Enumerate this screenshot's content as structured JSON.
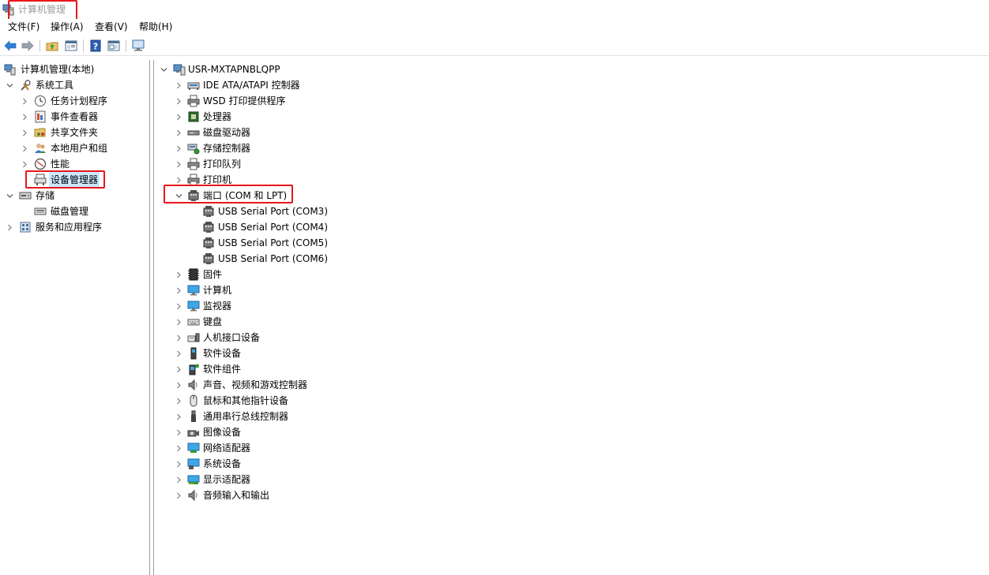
{
  "window": {
    "title": "计算机管理"
  },
  "menu": [
    "文件(F)",
    "操作(A)",
    "查看(V)",
    "帮助(H)"
  ],
  "toolbar": [
    "back-arrow-icon",
    "forward-arrow-icon",
    "up-folder-icon",
    "show-hide-tree-icon",
    "help-icon",
    "properties-icon",
    "monitor-icon"
  ],
  "left_tree": {
    "root": "计算机管理(本地)",
    "system_tools": "系统工具",
    "task_scheduler": "任务计划程序",
    "event_viewer": "事件查看器",
    "shared_folders": "共享文件夹",
    "local_users": "本地用户和组",
    "performance": "性能",
    "device_manager": "设备管理器",
    "storage": "存储",
    "disk_management": "磁盘管理",
    "services_apps": "服务和应用程序"
  },
  "device_tree": {
    "computer_name": "USR-MXTAPNBLQPP",
    "categories": [
      {
        "label": "IDE ATA/ATAPI 控制器",
        "icon": "ide-controller-icon"
      },
      {
        "label": "WSD 打印提供程序",
        "icon": "printer-icon"
      },
      {
        "label": "处理器",
        "icon": "cpu-icon"
      },
      {
        "label": "磁盘驱动器",
        "icon": "disk-drive-icon"
      },
      {
        "label": "存储控制器",
        "icon": "storage-controller-icon"
      },
      {
        "label": "打印队列",
        "icon": "printer-icon"
      },
      {
        "label": "打印机",
        "icon": "printer-icon"
      },
      {
        "label": "端口 (COM 和 LPT)",
        "icon": "port-icon",
        "expanded": true,
        "children": [
          "USB Serial Port (COM3)",
          "USB Serial Port (COM4)",
          "USB Serial Port (COM5)",
          "USB Serial Port (COM6)"
        ]
      },
      {
        "label": "固件",
        "icon": "firmware-chip-icon"
      },
      {
        "label": "计算机",
        "icon": "computer-monitor-icon"
      },
      {
        "label": "监视器",
        "icon": "computer-monitor-icon"
      },
      {
        "label": "键盘",
        "icon": "keyboard-icon"
      },
      {
        "label": "人机接口设备",
        "icon": "hid-icon"
      },
      {
        "label": "软件设备",
        "icon": "software-device-icon"
      },
      {
        "label": "软件组件",
        "icon": "software-component-icon"
      },
      {
        "label": "声音、视频和游戏控制器",
        "icon": "speaker-icon"
      },
      {
        "label": "鼠标和其他指针设备",
        "icon": "mouse-icon"
      },
      {
        "label": "通用串行总线控制器",
        "icon": "usb-icon"
      },
      {
        "label": "图像设备",
        "icon": "camera-icon"
      },
      {
        "label": "网络适配器",
        "icon": "network-adapter-icon"
      },
      {
        "label": "系统设备",
        "icon": "system-device-icon"
      },
      {
        "label": "显示适配器",
        "icon": "display-adapter-icon"
      },
      {
        "label": "音频输入和输出",
        "icon": "speaker-icon"
      }
    ]
  },
  "colors": {
    "highlight": "#e8161b",
    "selection": "#cce8ff"
  }
}
